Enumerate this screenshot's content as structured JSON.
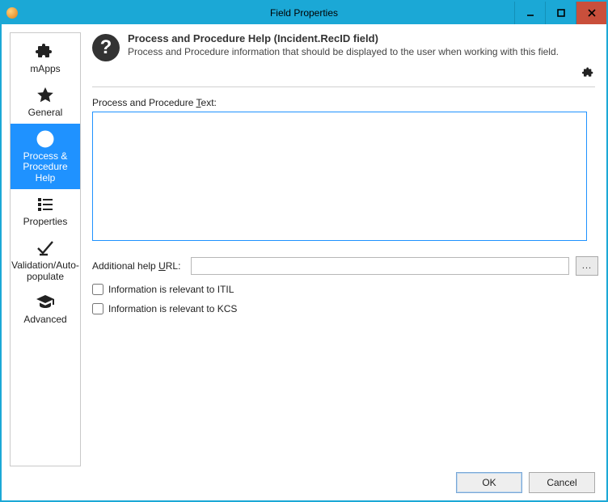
{
  "window": {
    "title": "Field Properties"
  },
  "nav": {
    "items": [
      {
        "key": "mapps",
        "label": "mApps"
      },
      {
        "key": "general",
        "label": "General"
      },
      {
        "key": "help",
        "label": "Process & Procedure Help"
      },
      {
        "key": "properties",
        "label": "Properties"
      },
      {
        "key": "validation",
        "label": "Validation/Auto-populate"
      },
      {
        "key": "advanced",
        "label": "Advanced"
      }
    ],
    "selected": "help"
  },
  "header": {
    "title": "Process and Procedure Help (Incident.RecID field)",
    "subtitle": "Process and Procedure information that should be displayed to the user when working with this field."
  },
  "form": {
    "text_label_pre": "Process and Procedure ",
    "text_label_u": "T",
    "text_label_post": "ext:",
    "text_value": "",
    "url_label_pre": "Additional help ",
    "url_label_u": "U",
    "url_label_post": "RL:",
    "url_value": "",
    "browse_label": "...",
    "itil_label": "Information is relevant to ITIL",
    "itil_checked": false,
    "kcs_label": "Information is relevant to KCS",
    "kcs_checked": false
  },
  "footer": {
    "ok": "OK",
    "cancel": "Cancel"
  }
}
